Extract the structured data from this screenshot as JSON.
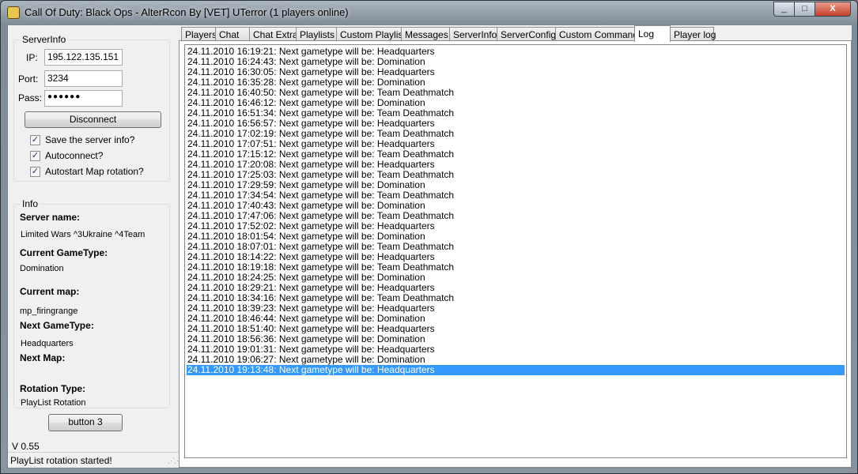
{
  "window": {
    "title": "Call Of Duty: Black Ops - AlterRcon By [VET] UTerror (1 players online)",
    "minimize": "_",
    "maximize": "□",
    "close": "X"
  },
  "server_info": {
    "group_label": "ServerInfo",
    "ip_label": "IP:",
    "ip_value": "195.122.135.151",
    "port_label": "Port:",
    "port_value": "3234",
    "pass_label": "Pass:",
    "pass_value": "●●●●●●",
    "disconnect_label": "Disconnect",
    "checkboxes": [
      {
        "label": "Save the server info?",
        "checked": true
      },
      {
        "label": "Autoconnect?",
        "checked": true
      },
      {
        "label": "Autostart Map rotation?",
        "checked": true
      }
    ],
    "check_glyph": "✓"
  },
  "info": {
    "group_label": "Info",
    "server_name_label": "Server name:",
    "server_name": "Limited Wars ^3Ukraine ^4Team",
    "current_gametype_label": "Current GameType:",
    "current_gametype": "Domination",
    "current_map_label": "Current map:",
    "current_map": "mp_firingrange",
    "next_gametype_label": "Next GameType:",
    "next_gametype": "Headquarters",
    "next_map_label": "Next Map:",
    "rotation_type_label": "Rotation Type:",
    "rotation_type": "PlayList Rotation"
  },
  "button3_label": "button 3",
  "version": "V 0.55",
  "status_text": "PlayList rotation started!",
  "tabs": [
    "Players",
    "Chat",
    "Chat Extra",
    "Playlists",
    "Custom Playlist",
    "Messages",
    "ServerInfo",
    "ServerConfig",
    "Custom Commands",
    "Log",
    "Player log"
  ],
  "selected_tab": "Log",
  "log": [
    "24.11.2010 16:19:21: Next gametype will be: Headquarters",
    "24.11.2010 16:24:43: Next gametype will be: Domination",
    "24.11.2010 16:30:05: Next gametype will be: Headquarters",
    "24.11.2010 16:35:28: Next gametype will be: Domination",
    "24.11.2010 16:40:50: Next gametype will be: Team Deathmatch",
    "24.11.2010 16:46:12: Next gametype will be: Domination",
    "24.11.2010 16:51:34: Next gametype will be: Team Deathmatch",
    "24.11.2010 16:56:57: Next gametype will be: Headquarters",
    "24.11.2010 17:02:19: Next gametype will be: Team Deathmatch",
    "24.11.2010 17:07:51: Next gametype will be: Headquarters",
    "24.11.2010 17:15:12: Next gametype will be: Team Deathmatch",
    "24.11.2010 17:20:08: Next gametype will be: Headquarters",
    "24.11.2010 17:25:03: Next gametype will be: Team Deathmatch",
    "24.11.2010 17:29:59: Next gametype will be: Domination",
    "24.11.2010 17:34:54: Next gametype will be: Team Deathmatch",
    "24.11.2010 17:40:43: Next gametype will be: Domination",
    "24.11.2010 17:47:06: Next gametype will be: Team Deathmatch",
    "24.11.2010 17:52:02: Next gametype will be: Headquarters",
    "24.11.2010 18:01:54: Next gametype will be: Domination",
    "24.11.2010 18:07:01: Next gametype will be: Team Deathmatch",
    "24.11.2010 18:14:22: Next gametype will be: Headquarters",
    "24.11.2010 18:19:18: Next gametype will be: Team Deathmatch",
    "24.11.2010 18:24:25: Next gametype will be: Domination",
    "24.11.2010 18:29:21: Next gametype will be: Headquarters",
    "24.11.2010 18:34:16: Next gametype will be: Team Deathmatch",
    "24.11.2010 18:39:23: Next gametype will be: Headquarters",
    "24.11.2010 18:46:44: Next gametype will be: Domination",
    "24.11.2010 18:51:40: Next gametype will be: Headquarters",
    "24.11.2010 18:56:36: Next gametype will be: Domination",
    "24.11.2010 19:01:31: Next gametype will be: Headquarters",
    "24.11.2010 19:06:27: Next gametype will be: Domination",
    "24.11.2010 19:13:48: Next gametype will be: Headquarters"
  ],
  "selected_log_index": 31
}
